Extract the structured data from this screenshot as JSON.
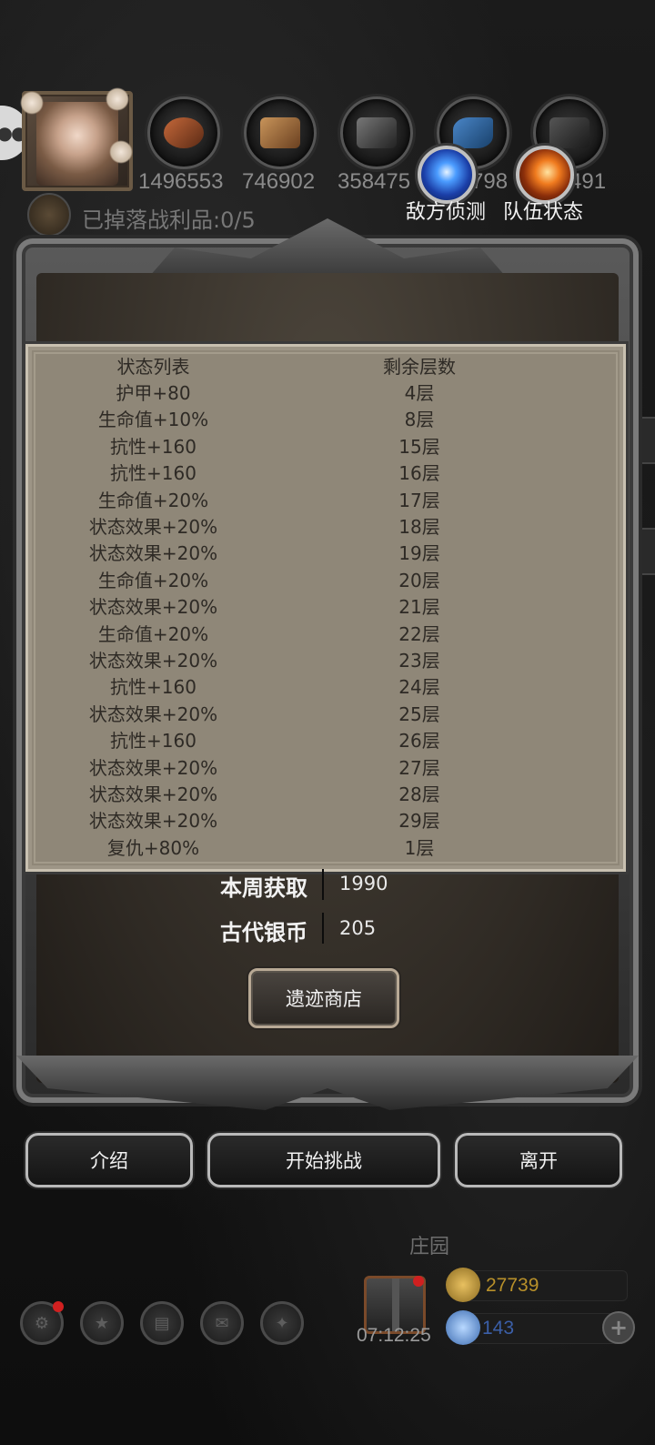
{
  "top_bar": {
    "resources": [
      {
        "name": "ore",
        "icon": "ore-icon",
        "value": "1496553"
      },
      {
        "name": "wood",
        "icon": "wood-icon",
        "value": "746902"
      },
      {
        "name": "iron",
        "icon": "iron-ingot-icon",
        "value": "358475"
      },
      {
        "name": "crystal",
        "icon": "crystal-icon",
        "value": "798"
      },
      {
        "name": "stone",
        "icon": "stone-icon",
        "value": "491"
      }
    ],
    "loot_text": "已掉落战利品:0/5",
    "enemy_scout_label": "敌方侦测",
    "team_status_label": "队伍状态"
  },
  "status_table": {
    "header": {
      "name": "状态列表",
      "layers": "剩余层数"
    },
    "rows": [
      {
        "name": "护甲+80",
        "layers": "4层"
      },
      {
        "name": "生命值+10%",
        "layers": "8层"
      },
      {
        "name": "抗性+160",
        "layers": "15层"
      },
      {
        "name": "抗性+160",
        "layers": "16层"
      },
      {
        "name": "生命值+20%",
        "layers": "17层"
      },
      {
        "name": "状态效果+20%",
        "layers": "18层"
      },
      {
        "name": "状态效果+20%",
        "layers": "19层"
      },
      {
        "name": "生命值+20%",
        "layers": "20层"
      },
      {
        "name": "状态效果+20%",
        "layers": "21层"
      },
      {
        "name": "生命值+20%",
        "layers": "22层"
      },
      {
        "name": "状态效果+20%",
        "layers": "23层"
      },
      {
        "name": "抗性+160",
        "layers": "24层"
      },
      {
        "name": "状态效果+20%",
        "layers": "25层"
      },
      {
        "name": "抗性+160",
        "layers": "26层"
      },
      {
        "name": "状态效果+20%",
        "layers": "27层"
      },
      {
        "name": "状态效果+20%",
        "layers": "28层"
      },
      {
        "name": "状态效果+20%",
        "layers": "29层"
      },
      {
        "name": "复仇+80%",
        "layers": "1层"
      }
    ]
  },
  "info": {
    "weekly_label": "本周获取",
    "weekly_value": "1990",
    "coin_label": "古代银币",
    "coin_value": "205"
  },
  "shop_button": "遗迹商店",
  "actions": {
    "intro": "介绍",
    "start": "开始挑战",
    "leave": "离开"
  },
  "footer": {
    "manor": "庄园",
    "timer": "07:12:25",
    "gold": "27739",
    "gems": "143",
    "dock_icons": [
      "settings-icon",
      "star-badge-icon",
      "rank-icon",
      "mail-icon",
      "guild-icon"
    ]
  },
  "colors": {
    "parchment": "#8f8778",
    "gold_text": "#b8902a",
    "gem_text": "#3b5fa8"
  }
}
